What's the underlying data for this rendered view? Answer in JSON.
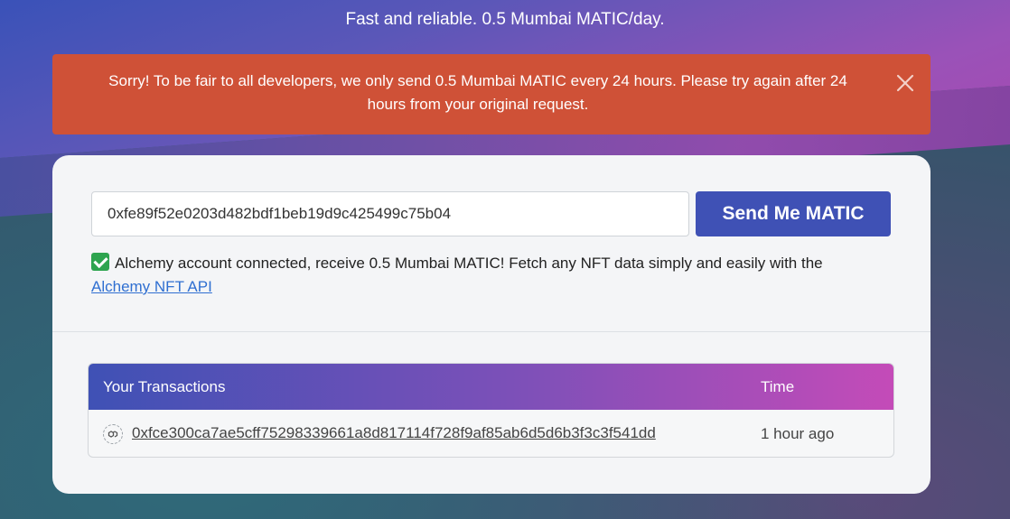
{
  "header": {
    "tagline": "Fast and reliable. 0.5 Mumbai MATIC/day."
  },
  "alert": {
    "message": "Sorry! To be fair to all developers, we only send 0.5 Mumbai MATIC every 24 hours. Please try again after 24 hours from your original request.",
    "close_icon": "close-icon",
    "color": "#cf5137"
  },
  "form": {
    "address_value": "0xfe89f52e0203d482bdf1beb19d9c425499c75b04",
    "send_label": "Send Me MATIC",
    "accent": "#3f51b5"
  },
  "notice": {
    "icon": "check-icon",
    "text": "Alchemy account connected, receive 0.5 Mumbai MATIC! Fetch any NFT data simply and easily with the",
    "link_label": "Alchemy NFT API"
  },
  "transactions": {
    "col_tx": "Your Transactions",
    "col_time": "Time",
    "rows": [
      {
        "icon": "polygon-icon",
        "hash": "0xfce300ca7ae5cff75298339661a8d817114f728f9af85ab6d5d6b3f3c3f541dd",
        "time": "1 hour ago"
      }
    ]
  }
}
